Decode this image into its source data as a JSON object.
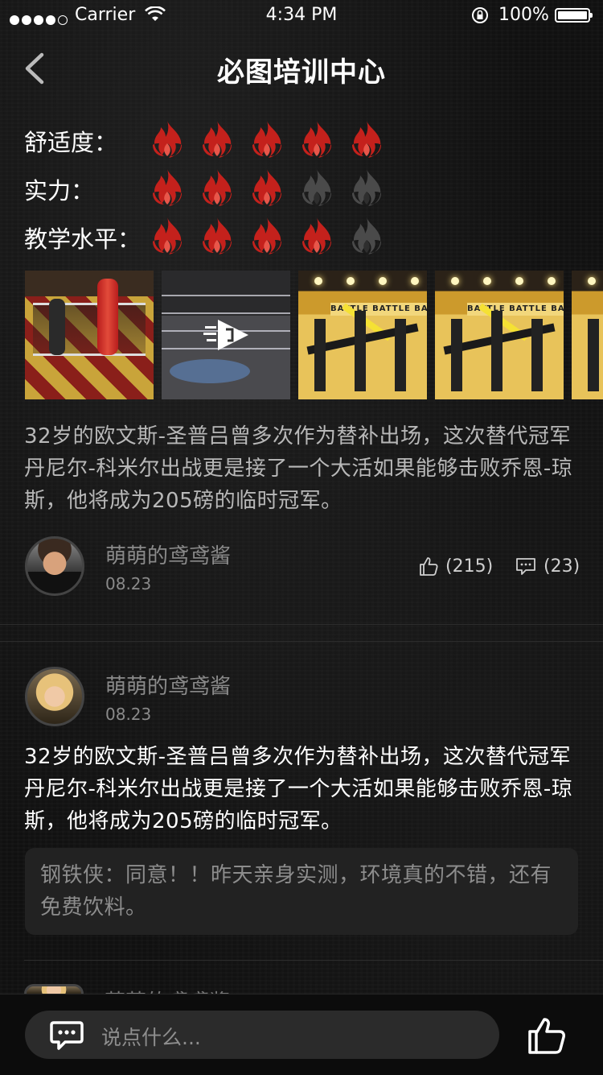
{
  "status_bar": {
    "carrier": "Carrier",
    "time": "4:34 PM",
    "battery": "100%"
  },
  "nav": {
    "title": "必图培训中心",
    "back_icon": "chevron-left-icon"
  },
  "ratings": [
    {
      "label": "舒适度：",
      "level": 5,
      "max": 5
    },
    {
      "label": "实力：",
      "level": 3,
      "max": 5
    },
    {
      "label": "教学水平：",
      "level": 4,
      "max": 5
    }
  ],
  "photos": [
    {
      "kind": "image",
      "alt": "gym-boxing-ring"
    },
    {
      "kind": "video",
      "alt": "ring-video"
    },
    {
      "kind": "image",
      "alt": "gym-machines",
      "banner": "BATTLE BATTLE BATTL"
    },
    {
      "kind": "image",
      "alt": "gym-machines",
      "banner": "BATTLE BATTLE BATTL"
    },
    {
      "kind": "image",
      "alt": "gym-machines"
    }
  ],
  "post": {
    "text": "32岁的欧文斯-圣普吕曾多次作为替补出场，这次替代冠军丹尼尔-科米尔出战更是接了一个大活如果能够击败乔恩-琼斯，他将成为205磅的临时冠军。",
    "author": "萌萌的鸢鸢酱",
    "date": "08.23",
    "likes": "(215)",
    "comments": "(23)"
  },
  "comment": {
    "author": "萌萌的鸢鸢酱",
    "date": "08.23",
    "text": "32岁的欧文斯-圣普吕曾多次作为替补出场，这次替代冠军丹尼尔-科米尔出战更是接了一个大活如果能够击败乔恩-琼斯，他将成为205磅的临时冠军。",
    "reply": "钢铁侠：同意！！昨天亲身实测，环境真的不错，还有免费饮料。"
  },
  "peek_author": "萌萌的鸢鸢酱",
  "bottom_bar": {
    "placeholder": "说点什么...",
    "chat_icon": "chat-bubble-icon",
    "like_icon": "thumbs-up-icon"
  },
  "colors": {
    "flame_active": "#c4211c",
    "flame_inactive": "#4a4a4a",
    "background": "#101010"
  }
}
